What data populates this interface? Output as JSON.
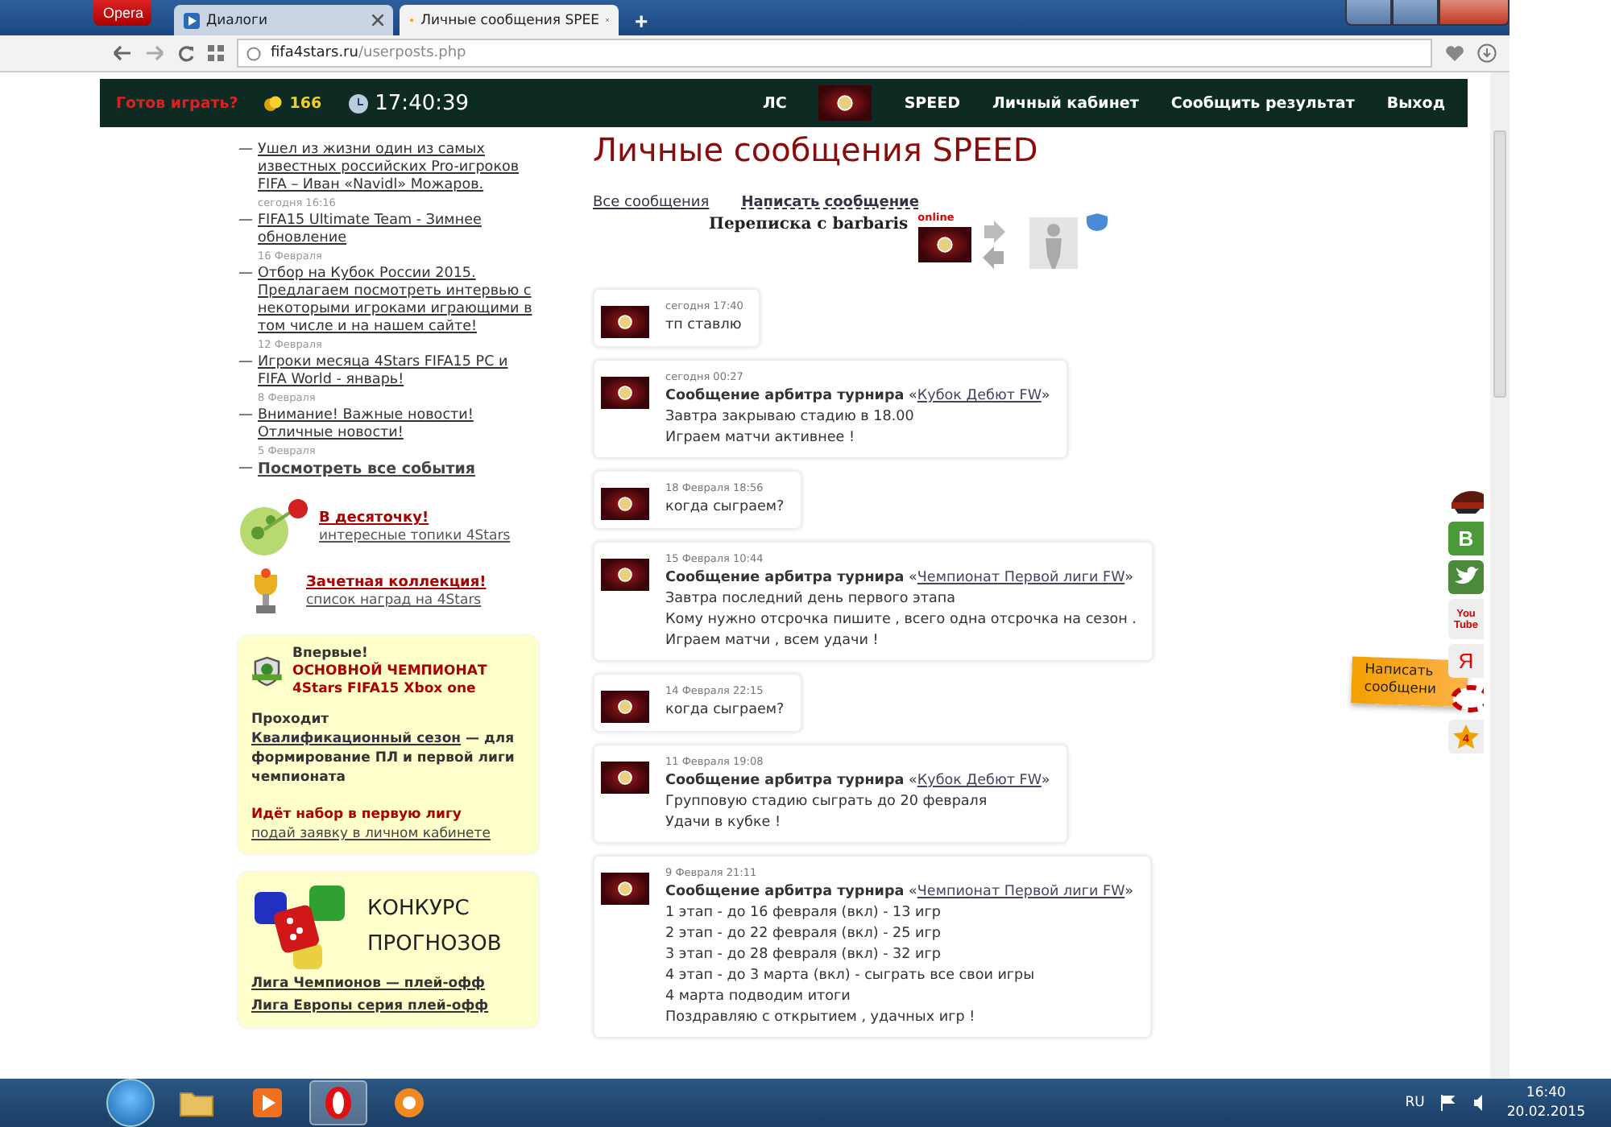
{
  "browser": {
    "menu_button": "Opera",
    "tabs": [
      {
        "title": "Диалоги",
        "selected": false
      },
      {
        "title": "Личные сообщения SPEE",
        "selected": true
      }
    ],
    "new_tab": "+",
    "address_host": "fifa4stars.ru",
    "address_path": "/userposts.php"
  },
  "site_nav": {
    "ready_prompt": "Готов играть?",
    "coins": "166",
    "clock": "17:40:39",
    "items": [
      {
        "kind": "text",
        "label": "ЛС"
      },
      {
        "kind": "avatar"
      },
      {
        "kind": "text",
        "label": "SPEED"
      },
      {
        "kind": "text",
        "label": "Личный кабинет"
      },
      {
        "kind": "text",
        "label": "Сообщить результат"
      },
      {
        "kind": "text",
        "label": "Выход"
      }
    ]
  },
  "news": [
    {
      "bullet": "—",
      "title": "Ушел из жизни один из самых известных российских Pro-игроков FIFA – Иван «Navidl» Можаров.",
      "date": "сегодня 16:16"
    },
    {
      "bullet": "—",
      "title": "FIFA15 Ultimate Team - Зимнее обновление",
      "date": "16 Февраля"
    },
    {
      "bullet": "—",
      "title": "Отбор на Кубок России 2015. Предлагаем посмотреть интервью с некоторыми игроками играющими в том числе и на нашем сайте!",
      "date": "12 Февраля"
    },
    {
      "bullet": "—",
      "title": "Игроки месяца 4Stars FIFA15 PC и FIFA World - январь!",
      "date": "8 Февраля"
    },
    {
      "bullet": "—",
      "title": "Внимание! Важные новости! Отличные новости!",
      "date": "5 Февраля"
    }
  ],
  "all_events": {
    "bullet": "—",
    "label": "Посмотреть все события"
  },
  "promos": [
    {
      "kind": "apple",
      "title": "В десяточку!",
      "subtitle": "интересные топики 4Stars"
    },
    {
      "kind": "trophy",
      "title": "Зачетная коллекция!",
      "subtitle": "список наград на 4Stars"
    }
  ],
  "xbox_card": {
    "intro": "Впервые!",
    "headline": "ОСНОВНОЙ ЧЕМПИОНАТ 4Stars FIFA15 Xbox one",
    "body_start": "Проходит",
    "body_link": "Квалификационный сезон",
    "body_end": "— для формирование ПЛ и первой лиги чемпионата",
    "recruit": "Идёт набор в первую лигу",
    "recruit_link": "подай заявку в личном кабинете"
  },
  "forecast_card": {
    "title": "КОНКУРС ПРОГНОЗОВ",
    "links": [
      "Лига Чемпионов — плей-офф",
      "Лига Европы серия плей-офф"
    ]
  },
  "page_title": "Личные сообщения SPEED",
  "message_tabs": [
    {
      "label": "Все сообщения",
      "selected": false
    },
    {
      "label": "Написать сообщение",
      "selected": true
    }
  ],
  "correspondence": {
    "title": "Переписка с barbaris",
    "status": "online"
  },
  "messages": [
    {
      "kind": "user",
      "date": "сегодня 17:40",
      "lines": [
        "тп ставлю"
      ]
    },
    {
      "kind": "arbiter",
      "date": "сегодня 00:27",
      "heading": "Сообщение арбитра турнира",
      "quote_open": "«",
      "tournament": "Кубок Дебют FW",
      "quote_close": "»",
      "lines": [
        "Завтра закрываю стадию в 18.00",
        "Играем матчи активнее !"
      ]
    },
    {
      "kind": "user",
      "date": "18 Февраля 18:56",
      "lines": [
        "когда сыграем?"
      ]
    },
    {
      "kind": "arbiter",
      "date": "15 Февраля 10:44",
      "heading": "Сообщение арбитра турнира",
      "quote_open": "«",
      "tournament": "Чемпионат Первой лиги FW",
      "quote_close": "»",
      "lines": [
        "Завтра последний день первого этапа",
        "Кому нужно отсрочка пишите , всего одна отсрочка на сезон .",
        "Играем матчи , всем удачи !"
      ]
    },
    {
      "kind": "user",
      "date": "14 Февраля 22:15",
      "lines": [
        "когда сыграем?"
      ]
    },
    {
      "kind": "arbiter",
      "date": "11 Февраля 19:08",
      "heading": "Сообщение арбитра турнира",
      "quote_open": "«",
      "tournament": "Кубок Дебют FW",
      "quote_close": "»",
      "lines": [
        "Групповую стадию сыграть до 20 февраля",
        "Удачи в кубке !"
      ]
    },
    {
      "kind": "arbiter",
      "date": "9 Февраля 21:11",
      "heading": "Сообщение арбитра турнира",
      "quote_open": "«",
      "tournament": "Чемпионат Первой лиги FW",
      "quote_close": "»",
      "lines": [
        "1 этап - до 16 февраля (вкл) - 13 игр",
        "2 этап - до 22 февраля (вкл) - 25 игр",
        "3 этап - до 28 февраля (вкл) - 32 игр",
        "4 этап - до 3 марта (вкл) - сыграть все свои игры",
        "4 марта подводим итоги",
        "Поздравляю с открытием , удачных игр !"
      ]
    }
  ],
  "side_widget": {
    "tooltip": "Написать сообщени",
    "buttons": [
      {
        "kind": "cap"
      },
      {
        "kind": "vk",
        "glyph": "B"
      },
      {
        "kind": "twitter"
      },
      {
        "kind": "youtube",
        "glyph": "You Tube"
      },
      {
        "kind": "yandex",
        "glyph": "Я"
      },
      {
        "kind": "lifebuoy"
      },
      {
        "kind": "star",
        "glyph": "4"
      }
    ]
  },
  "taskbar": {
    "apps": [
      {
        "kind": "folder",
        "selected": false
      },
      {
        "kind": "media",
        "selected": false
      },
      {
        "kind": "opera",
        "selected": true
      },
      {
        "kind": "orange",
        "selected": false
      }
    ],
    "language": "RU",
    "time": "16:40",
    "date": "20.02.2015"
  }
}
